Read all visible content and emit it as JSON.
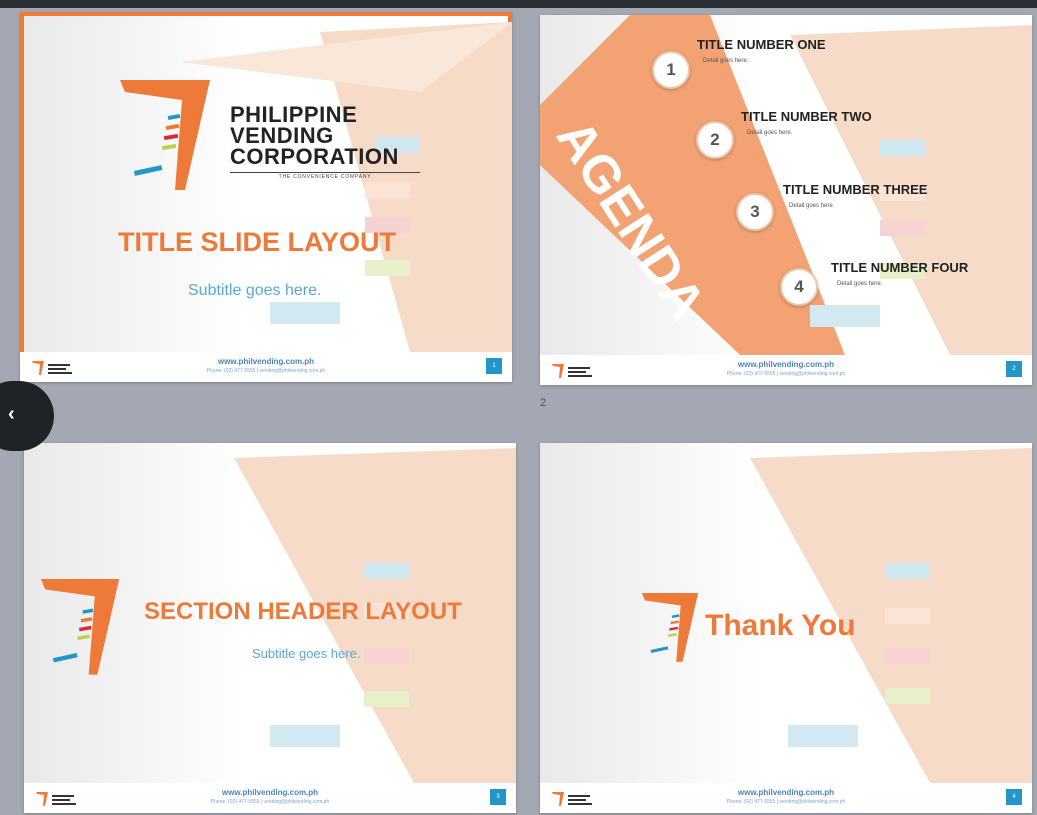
{
  "viewer": {
    "accent_color": "#ee7a3a",
    "selection_color": "#ee7a3a",
    "page_indicator": "2",
    "prev_button_icon": "chevron-left-icon",
    "prev_glyph": "‹"
  },
  "footer": {
    "url": "www.philvending.com.ph",
    "contact": "Phone: (02) 477-5555 | vending@philvending.com.ph"
  },
  "slides": [
    {
      "page_number": "1",
      "selected": true,
      "company_name_line1": "PHILIPPINE",
      "company_name_line2": "VENDING",
      "company_name_line3": "CORPORATION",
      "tagline": "THE CONVENIENCE COMPANY",
      "title": "TITLE SLIDE LAYOUT",
      "subtitle": "Subtitle goes here."
    },
    {
      "page_number": "2",
      "selected": false,
      "banner": "AGENDA",
      "items": [
        {
          "number": "1",
          "title": "TITLE NUMBER ONE",
          "detail": "Detail goes here."
        },
        {
          "number": "2",
          "title": "TITLE NUMBER TWO",
          "detail": "Detail goes here."
        },
        {
          "number": "3",
          "title": "TITLE NUMBER THREE",
          "detail": "Detail goes here."
        },
        {
          "number": "4",
          "title": "TITLE NUMBER FOUR",
          "detail": "Detail goes here."
        }
      ]
    },
    {
      "page_number": "3",
      "selected": false,
      "title": "SECTION HEADER LAYOUT",
      "subtitle": "Subtitle goes here."
    },
    {
      "page_number": "4",
      "selected": false,
      "title": "Thank You"
    }
  ]
}
